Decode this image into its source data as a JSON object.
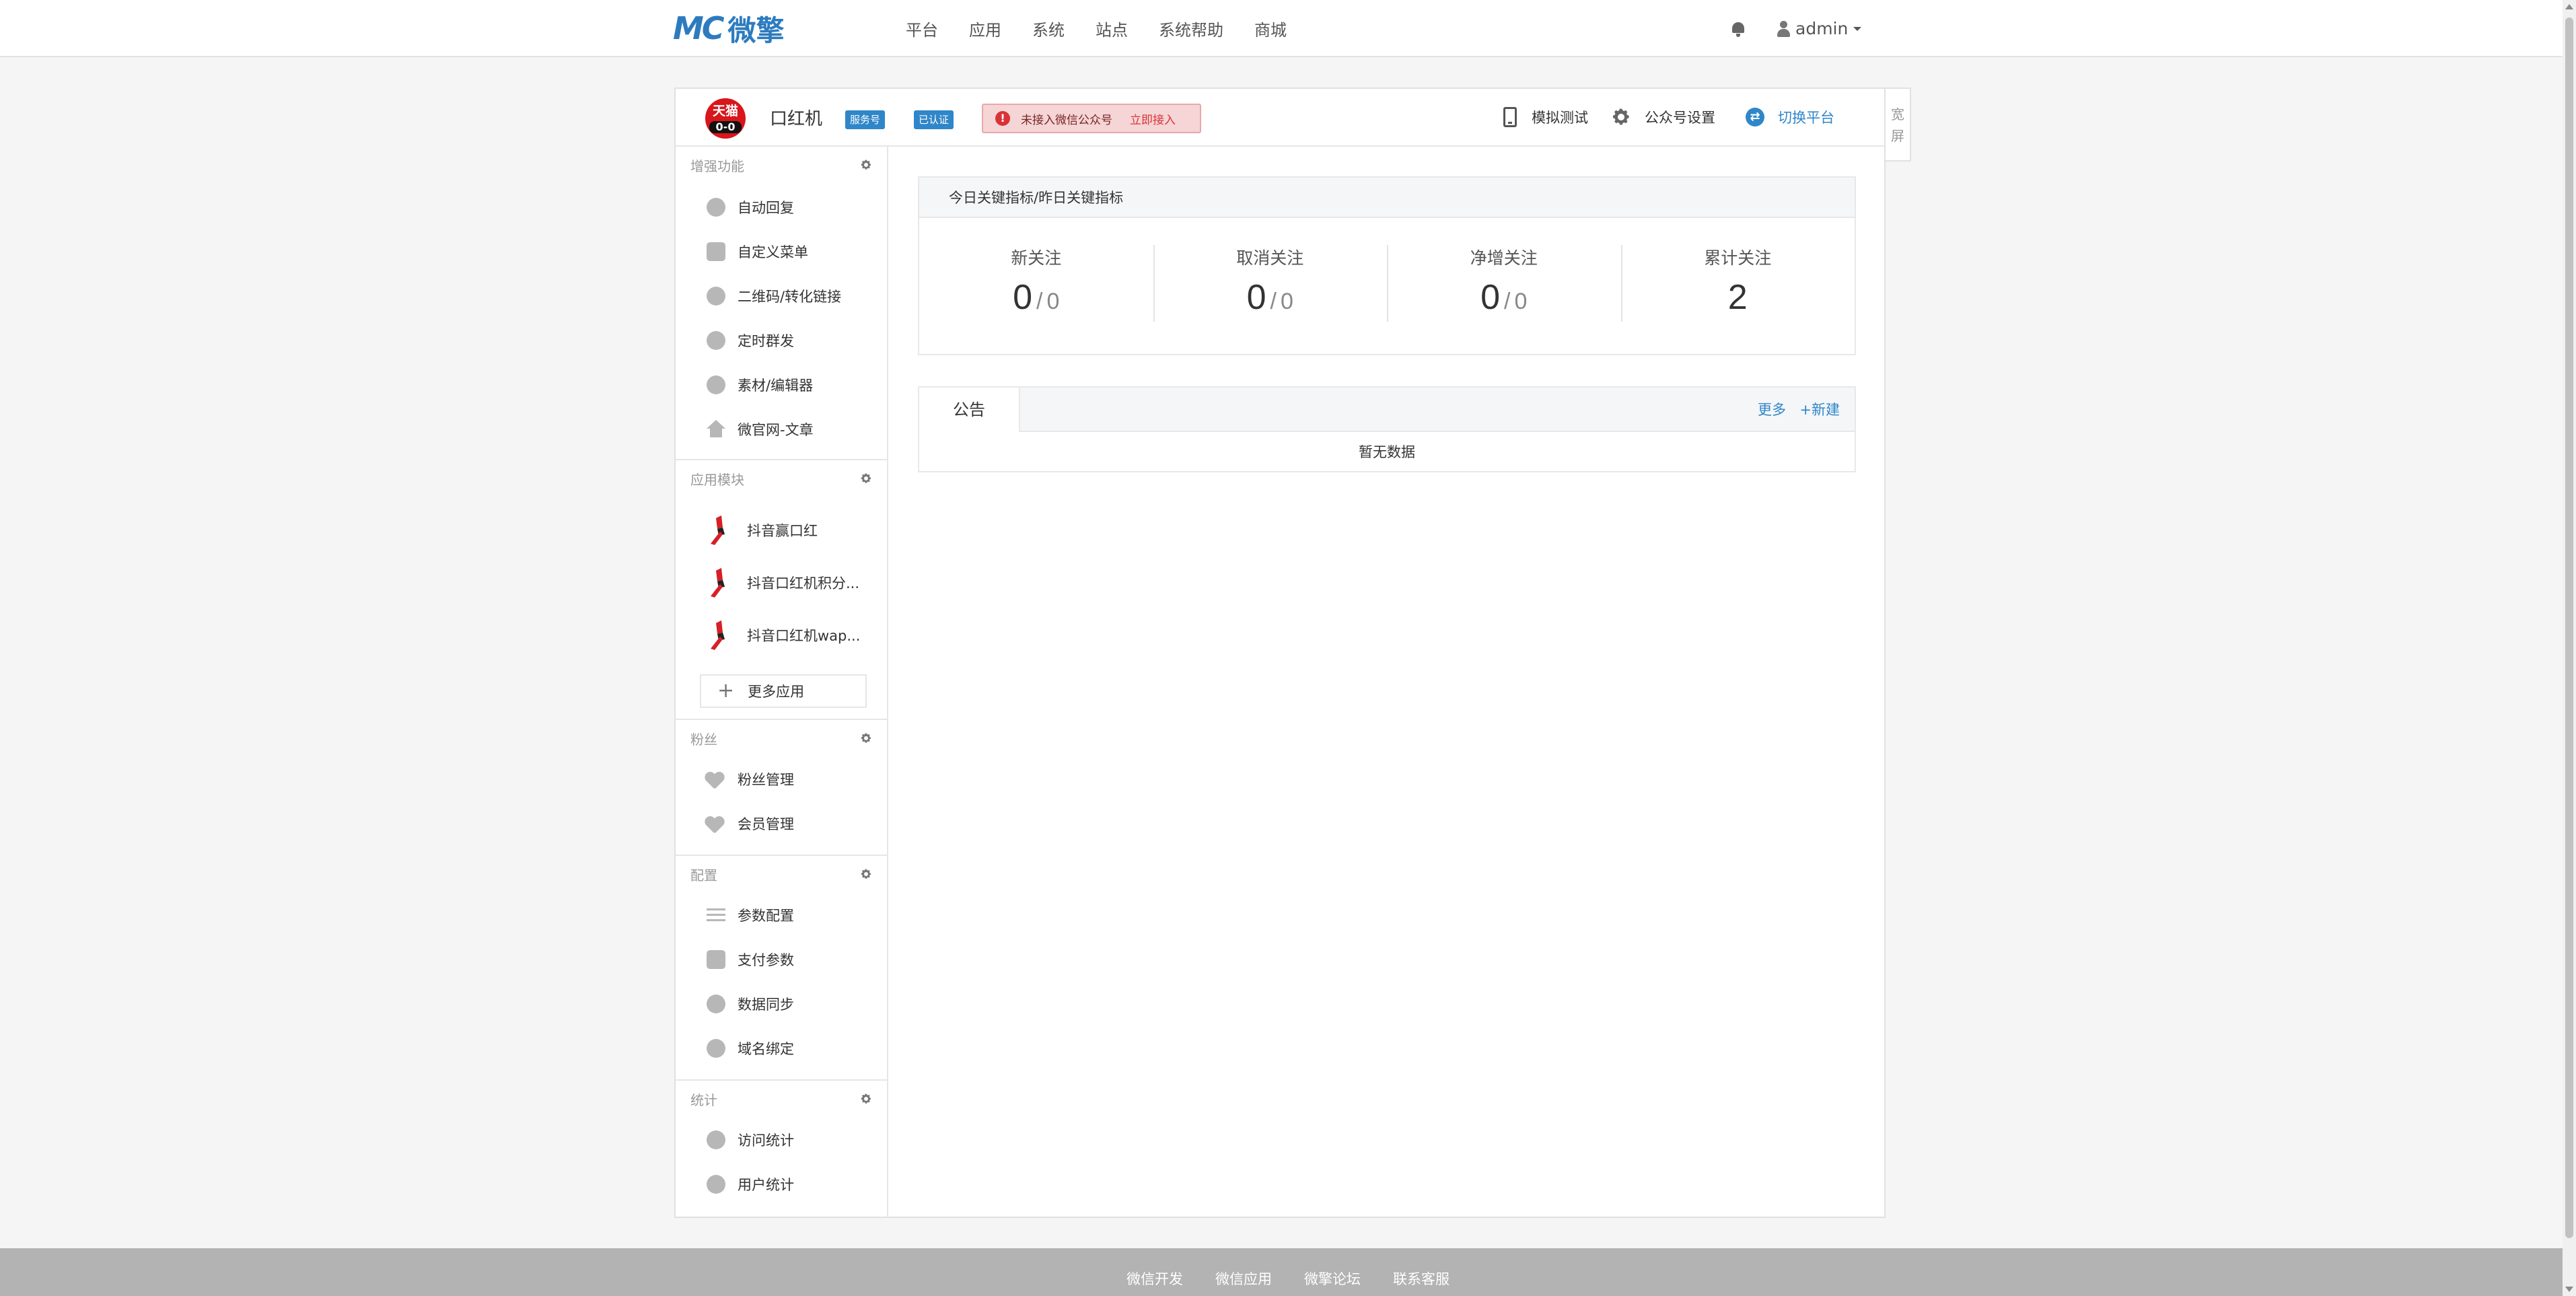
{
  "brand": {
    "mark": "MC",
    "name": "微擎",
    "color": "#2d7bbf"
  },
  "nav": [
    "平台",
    "应用",
    "系统",
    "站点",
    "系统帮助",
    "商城"
  ],
  "user": {
    "name": "admin",
    "bell_icon": "bell-icon",
    "user_icon": "user-icon"
  },
  "account": {
    "avatar_text": "天猫",
    "avatar_eyes": "0-0",
    "name": "口红机",
    "badges": [
      "服务号",
      "已认证"
    ],
    "alert_text": "未接入微信公众号",
    "alert_link": "立即接入",
    "actions": [
      "模拟测试",
      "公众号设置",
      "切换平台"
    ],
    "wide_screen": [
      "宽",
      "屏"
    ]
  },
  "sidebar": {
    "sections": [
      {
        "title": "增强功能",
        "items": [
          "自动回复",
          "自定义菜单",
          "二维码/转化链接",
          "定时群发",
          "素材/编辑器",
          "微官网-文章"
        ]
      },
      {
        "title": "应用模块",
        "items": [
          "抖音赢口红",
          "抖音口红机积分...",
          "抖音口红机wap..."
        ],
        "more": "更多应用"
      },
      {
        "title": "粉丝",
        "items": [
          "粉丝管理",
          "会员管理"
        ]
      },
      {
        "title": "配置",
        "items": [
          "参数配置",
          "支付参数",
          "数据同步",
          "域名绑定"
        ]
      },
      {
        "title": "统计",
        "items": [
          "访问统计",
          "用户统计"
        ]
      }
    ]
  },
  "stats": {
    "title": "今日关键指标/昨日关键指标",
    "items": [
      {
        "label": "新关注",
        "today": "0",
        "yesterday": "0"
      },
      {
        "label": "取消关注",
        "today": "0",
        "yesterday": "0"
      },
      {
        "label": "净增关注",
        "today": "0",
        "yesterday": "0"
      },
      {
        "label": "累计关注",
        "today": "2"
      }
    ]
  },
  "notice": {
    "tab": "公告",
    "more": "更多",
    "new": "+新建",
    "empty": "暂无数据"
  },
  "footer": [
    "微信开发",
    "微信应用",
    "微擎论坛",
    "联系客服"
  ],
  "colors": {
    "accent": "#2f86c9",
    "alert_bg": "#f5d5d5",
    "danger": "#d9333a",
    "footer_bg": "#b3b3b3"
  }
}
